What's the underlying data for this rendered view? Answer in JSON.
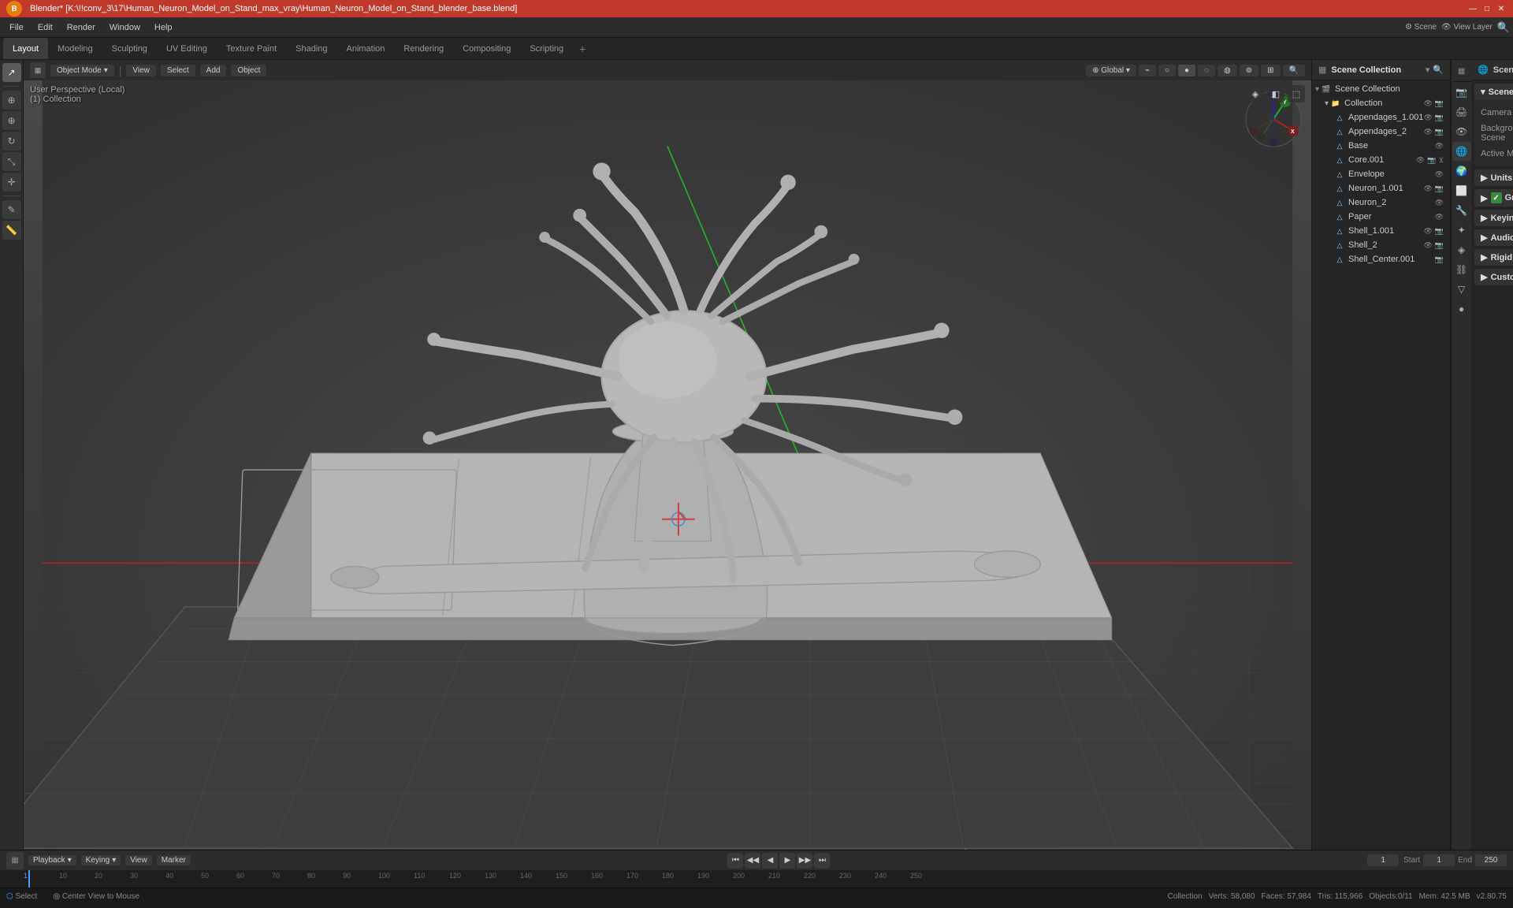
{
  "window": {
    "title": "Blender* [K:\\!!conv_3\\17\\Human_Neuron_Model_on_Stand_max_vray\\Human_Neuron_Model_on_Stand_blender_base.blend]",
    "controls": [
      "—",
      "□",
      "✕"
    ]
  },
  "menubar": {
    "items": [
      "Blender",
      "File",
      "Edit",
      "Render",
      "Window",
      "Help"
    ]
  },
  "workspace_tabs": {
    "tabs": [
      "Layout",
      "Modeling",
      "Sculpting",
      "UV Editing",
      "Texture Paint",
      "Shading",
      "Animation",
      "Rendering",
      "Compositing",
      "Scripting"
    ],
    "active": "Layout",
    "add_label": "+"
  },
  "viewport": {
    "mode_label": "Object Mode",
    "mode_dropdown": "▾",
    "view_label": "View",
    "select_label": "Select",
    "add_label": "Add",
    "object_label": "Object",
    "shading_label": "Global",
    "perspective_label": "User Perspective (Local)",
    "collection_label": "(1) Collection"
  },
  "nav_gizmo": {
    "x_label": "X",
    "y_label": "Y",
    "z_label": "Z"
  },
  "outliner": {
    "header_label": "Scene Collection",
    "items": [
      {
        "name": "Collection",
        "level": 1,
        "icon": "📁",
        "visible": true,
        "render": true
      },
      {
        "name": "Appendages_1.001",
        "level": 2,
        "icon": "△",
        "visible": true,
        "render": true
      },
      {
        "name": "Appendages_2",
        "level": 2,
        "icon": "△",
        "visible": true,
        "render": true
      },
      {
        "name": "Base",
        "level": 2,
        "icon": "△",
        "visible": true,
        "render": true
      },
      {
        "name": "Core.001",
        "level": 2,
        "icon": "△",
        "visible": true,
        "render": true
      },
      {
        "name": "Envelope",
        "level": 2,
        "icon": "△",
        "visible": true,
        "render": true
      },
      {
        "name": "Neuron_1.001",
        "level": 2,
        "icon": "△",
        "visible": true,
        "render": true
      },
      {
        "name": "Neuron_2",
        "level": 2,
        "icon": "△",
        "visible": true,
        "render": true
      },
      {
        "name": "Paper",
        "level": 2,
        "icon": "△",
        "visible": true,
        "render": true
      },
      {
        "name": "Shell_1.001",
        "level": 2,
        "icon": "△",
        "visible": true,
        "render": true
      },
      {
        "name": "Shell_2",
        "level": 2,
        "icon": "△",
        "visible": true,
        "render": true
      },
      {
        "name": "Shell_Center.001",
        "level": 2,
        "icon": "△",
        "visible": true,
        "render": true
      }
    ]
  },
  "properties": {
    "header_label": "Scene",
    "active_panel": "scene",
    "tabs": [
      {
        "icon": "🎬",
        "name": "render-tab",
        "label": "Render"
      },
      {
        "icon": "📊",
        "name": "output-tab",
        "label": "Output"
      },
      {
        "icon": "👁",
        "name": "view-layer-tab",
        "label": "View Layer"
      },
      {
        "icon": "🌐",
        "name": "scene-tab",
        "label": "Scene"
      },
      {
        "icon": "🌍",
        "name": "world-tab",
        "label": "World"
      },
      {
        "icon": "⚙",
        "name": "object-tab",
        "label": "Object"
      },
      {
        "icon": "✦",
        "name": "modifier-tab",
        "label": "Modifier"
      },
      {
        "icon": "👤",
        "name": "particles-tab",
        "label": "Particles"
      },
      {
        "icon": "🔧",
        "name": "physics-tab",
        "label": "Physics"
      },
      {
        "icon": "💡",
        "name": "constraints-tab",
        "label": "Constraints"
      },
      {
        "icon": "📐",
        "name": "data-tab",
        "label": "Data"
      },
      {
        "icon": "🎨",
        "name": "material-tab",
        "label": "Material"
      }
    ],
    "scene_label": "Scene",
    "scene_name": "Scene",
    "sections": [
      {
        "name": "scene-section",
        "label": "Scene",
        "expanded": true,
        "rows": [
          {
            "label": "Camera",
            "value": "",
            "type": "picker"
          },
          {
            "label": "Background Scene",
            "value": "",
            "type": "picker"
          },
          {
            "label": "Active Movie Clip",
            "value": "",
            "type": "picker"
          }
        ]
      },
      {
        "name": "units-section",
        "label": "Units",
        "expanded": false,
        "rows": []
      },
      {
        "name": "gravity-section",
        "label": "Gravity",
        "expanded": false,
        "has_checkbox": true,
        "checked": true,
        "rows": []
      },
      {
        "name": "keying-sets-section",
        "label": "Keying Sets",
        "expanded": false,
        "rows": []
      },
      {
        "name": "audio-section",
        "label": "Audio",
        "expanded": false,
        "rows": []
      },
      {
        "name": "rigid-body-world-section",
        "label": "Rigid Body World",
        "expanded": false,
        "rows": []
      },
      {
        "name": "custom-properties-section",
        "label": "Custom Properties",
        "expanded": false,
        "rows": []
      }
    ]
  },
  "timeline": {
    "playback_label": "Playback",
    "playback_dropdown": "▾",
    "keying_label": "Keying",
    "keying_dropdown": "▾",
    "view_label": "View",
    "marker_label": "Marker",
    "current_frame": "1",
    "start_label": "Start",
    "start_frame": "1",
    "end_label": "End",
    "end_frame": "250",
    "frames": [
      1,
      10,
      20,
      30,
      40,
      50,
      60,
      70,
      80,
      90,
      100,
      110,
      120,
      130,
      140,
      150,
      160,
      170,
      180,
      190,
      200,
      210,
      220,
      230,
      240,
      250
    ]
  },
  "status_bar": {
    "collection_label": "Collection",
    "verts_label": "Verts:",
    "verts_value": "58,080",
    "faces_label": "Faces:",
    "faces_value": "57,984",
    "tris_label": "Tris:",
    "tris_value": "115,966",
    "objects_label": "Objects:0/11",
    "memory_label": "Mem: 42.5 MB",
    "version_label": "v2.80.75"
  },
  "bottom_bar": {
    "select_label": "Select",
    "center_view_label": "Center View to Mouse"
  },
  "view_layer": {
    "label": "View Layer"
  }
}
